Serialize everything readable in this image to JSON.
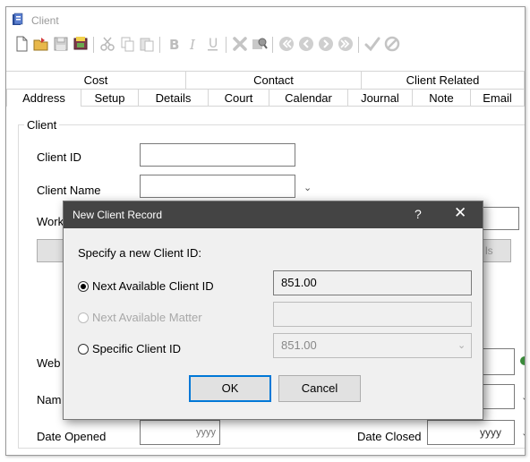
{
  "window": {
    "title": "Client"
  },
  "toolbar": {
    "icons": [
      "new-document-icon",
      "open-folder-icon",
      "save-icon",
      "notes-icon",
      "cut-icon",
      "copy-icon",
      "paste-icon",
      "bold-icon",
      "italic-icon",
      "underline-icon",
      "delete-icon",
      "search-record-icon",
      "first-record-icon",
      "previous-record-icon",
      "next-record-icon",
      "last-record-icon",
      "confirm-icon",
      "cancel-icon"
    ]
  },
  "tabs_top": [
    "Cost",
    "Contact",
    "Client Related"
  ],
  "tabs_bottom": [
    "Address",
    "Setup",
    "Details",
    "Court",
    "Calendar",
    "Journal",
    "Note",
    "Email"
  ],
  "form": {
    "group_label": "Client",
    "client_id_label": "Client ID",
    "client_name_label": "Client Name",
    "work_label": "Work",
    "web_label": "Web",
    "name_label": "Nam",
    "date_opened_label": "Date Opened",
    "date_closed_label": "Date Closed",
    "hidden_button_fragment": "ls",
    "date_format_left": "yyyy",
    "date_format_right": "yyyy"
  },
  "dialog": {
    "title": "New Client Record",
    "help": "?",
    "close": "✕",
    "prompt": "Specify a new Client ID:",
    "options": [
      {
        "label": "Next Available Client ID",
        "value": "851.00",
        "checked": true,
        "enabled": true
      },
      {
        "label": "Next Available Matter",
        "value": "",
        "checked": false,
        "enabled": false
      },
      {
        "label": "Specific Client ID",
        "value": "851.00",
        "checked": false,
        "enabled": true
      }
    ],
    "ok_label": "OK",
    "cancel_label": "Cancel"
  }
}
